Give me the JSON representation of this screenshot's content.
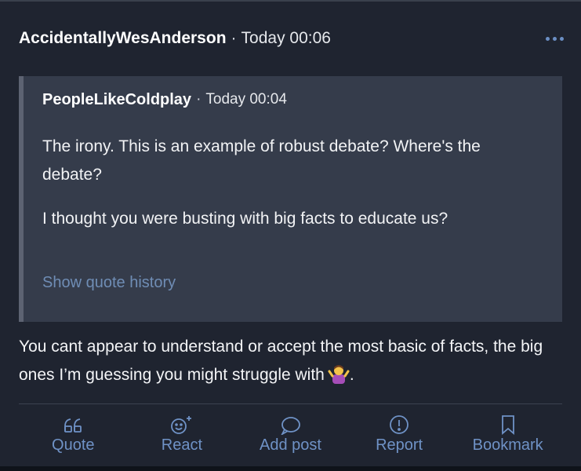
{
  "post": {
    "author": "AccidentallyWesAnderson",
    "separator": "·",
    "time": "Today 00:06",
    "more_icon": "ellipsis-icon",
    "quote": {
      "author": "PeopleLikeColdplay",
      "separator": "·",
      "time": "Today 00:04",
      "paragraphs": [
        "The irony. This is an example of robust debate? Where's the debate?",
        "I thought you were busting with big facts to educate us?"
      ],
      "show_history": "Show quote history"
    },
    "body_text": "You cant appear to understand or accept the most basic of facts, the big ones I’m guessing you might struggle with",
    "body_end": ".",
    "emoji": "person-shrugging-emoji"
  },
  "actions": {
    "quote": "Quote",
    "react": "React",
    "add_post": "Add post",
    "report": "Report",
    "bookmark": "Bookmark"
  },
  "colors": {
    "background": "#1f2430",
    "quote_background": "#353c4b",
    "accent": "#6f92c6"
  }
}
